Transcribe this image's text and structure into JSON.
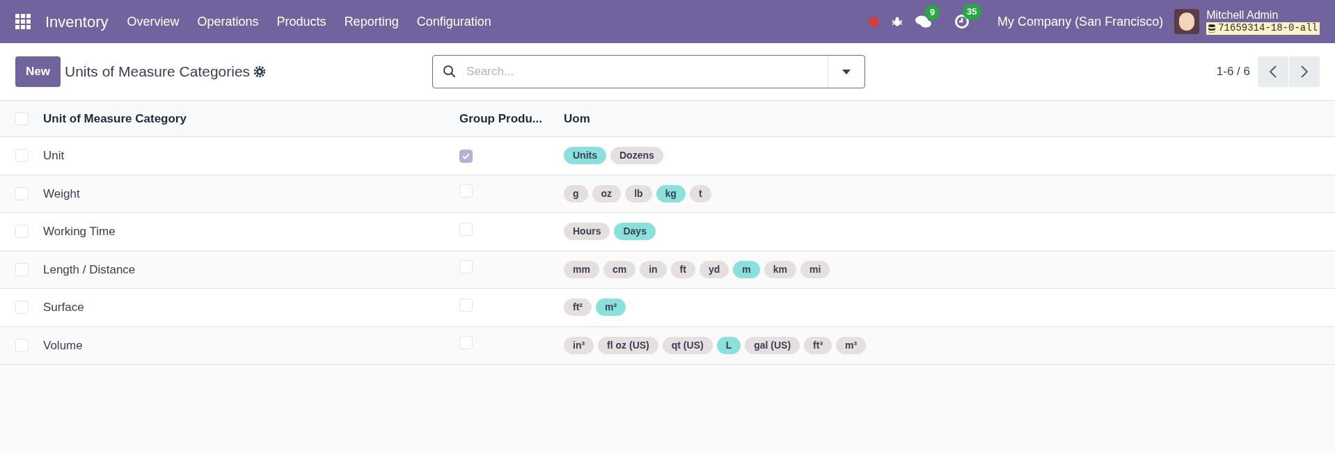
{
  "navbar": {
    "app_name": "Inventory",
    "menu": [
      "Overview",
      "Operations",
      "Products",
      "Reporting",
      "Configuration"
    ],
    "messages_count": "9",
    "activities_count": "35",
    "company": "My Company (San Francisco)",
    "user": "Mitchell Admin",
    "database": "71659314-18-0-all"
  },
  "control_panel": {
    "new_button": "New",
    "title": "Units of Measure Categories",
    "search": {
      "placeholder": "Search..."
    },
    "pager": "1-6 / 6"
  },
  "table": {
    "select_all": false,
    "columns": [
      "Unit of Measure Category",
      "Group Produ...",
      "Uom"
    ],
    "rows": [
      {
        "name": "Unit",
        "selected": false,
        "group": true,
        "uoms": [
          {
            "label": "Units",
            "color": "#8ae0da"
          },
          {
            "label": "Dozens",
            "color": "#e6dfdf"
          }
        ]
      },
      {
        "name": "Weight",
        "selected": false,
        "group": false,
        "uoms": [
          {
            "label": "g",
            "color": "#e6dfdf"
          },
          {
            "label": "oz",
            "color": "#e6dfdf"
          },
          {
            "label": "lb",
            "color": "#e6dfdf"
          },
          {
            "label": "kg",
            "color": "#8ae0da"
          },
          {
            "label": "t",
            "color": "#e6dfdf"
          }
        ]
      },
      {
        "name": "Working Time",
        "selected": false,
        "group": false,
        "uoms": [
          {
            "label": "Hours",
            "color": "#e6dfdf"
          },
          {
            "label": "Days",
            "color": "#8ae0da"
          }
        ]
      },
      {
        "name": "Length / Distance",
        "selected": false,
        "group": false,
        "uoms": [
          {
            "label": "mm",
            "color": "#e6dfdf"
          },
          {
            "label": "cm",
            "color": "#e6dfdf"
          },
          {
            "label": "in",
            "color": "#e6dfdf"
          },
          {
            "label": "ft",
            "color": "#e6dfdf"
          },
          {
            "label": "yd",
            "color": "#e6dfdf"
          },
          {
            "label": "m",
            "color": "#8ae0da"
          },
          {
            "label": "km",
            "color": "#e6dfdf"
          },
          {
            "label": "mi",
            "color": "#e6dfdf"
          }
        ]
      },
      {
        "name": "Surface",
        "selected": false,
        "group": false,
        "uoms": [
          {
            "label": "ft²",
            "color": "#e6dfdf"
          },
          {
            "label": "m²",
            "color": "#8ae0da"
          }
        ]
      },
      {
        "name": "Volume",
        "selected": false,
        "group": false,
        "uoms": [
          {
            "label": "in³",
            "color": "#e6dfdf"
          },
          {
            "label": "fl oz (US)",
            "color": "#e6dfdf"
          },
          {
            "label": "qt (US)",
            "color": "#e6dfdf"
          },
          {
            "label": "L",
            "color": "#8ae0da"
          },
          {
            "label": "gal (US)",
            "color": "#e6dfdf"
          },
          {
            "label": "ft³",
            "color": "#e6dfdf"
          },
          {
            "label": "m³",
            "color": "#e6dfdf"
          }
        ]
      }
    ]
  }
}
